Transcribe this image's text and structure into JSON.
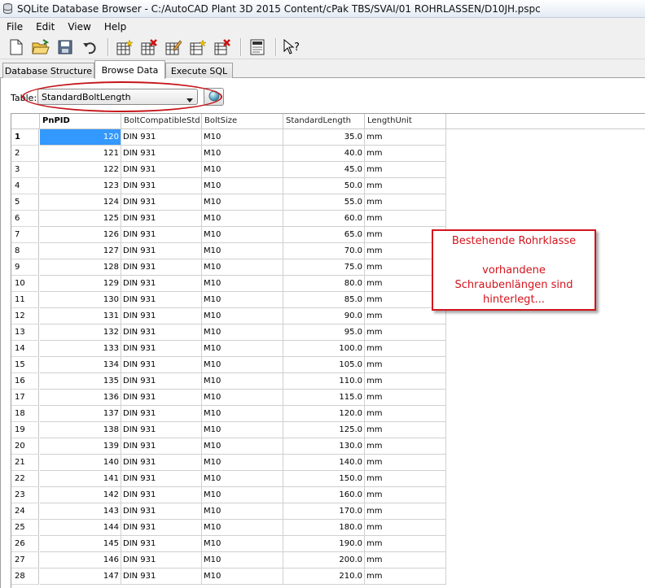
{
  "window": {
    "title": "SQLite Database Browser - C:/AutoCAD Plant 3D 2015 Content/cPak TBS/SVAI/01 ROHRLASSEN/D10JH.pspc"
  },
  "menu": [
    "File",
    "Edit",
    "View",
    "Help"
  ],
  "toolbar": {
    "buttons": [
      "new-database",
      "open-database",
      "save-database",
      "undo",
      "create-table",
      "delete-table",
      "modify-table",
      "create-index",
      "delete-index",
      "log",
      "whats-this"
    ]
  },
  "tabs": [
    {
      "label": "Database Structure",
      "active": false
    },
    {
      "label": "Browse Data",
      "active": true
    },
    {
      "label": "Execute SQL",
      "active": false
    }
  ],
  "browse": {
    "table_label": "Table:",
    "table_value": "StandardBoltLength"
  },
  "grid": {
    "columns": [
      "PnPID",
      "BoltCompatibleStd",
      "BoltSize",
      "StandardLength",
      "LengthUnit"
    ],
    "selected_cell": "120",
    "rows": [
      [
        "1",
        "120",
        "DIN 931",
        "M10",
        "35.0",
        "mm"
      ],
      [
        "2",
        "121",
        "DIN 931",
        "M10",
        "40.0",
        "mm"
      ],
      [
        "3",
        "122",
        "DIN 931",
        "M10",
        "45.0",
        "mm"
      ],
      [
        "4",
        "123",
        "DIN 931",
        "M10",
        "50.0",
        "mm"
      ],
      [
        "5",
        "124",
        "DIN 931",
        "M10",
        "55.0",
        "mm"
      ],
      [
        "6",
        "125",
        "DIN 931",
        "M10",
        "60.0",
        "mm"
      ],
      [
        "7",
        "126",
        "DIN 931",
        "M10",
        "65.0",
        "mm"
      ],
      [
        "8",
        "127",
        "DIN 931",
        "M10",
        "70.0",
        "mm"
      ],
      [
        "9",
        "128",
        "DIN 931",
        "M10",
        "75.0",
        "mm"
      ],
      [
        "10",
        "129",
        "DIN 931",
        "M10",
        "80.0",
        "mm"
      ],
      [
        "11",
        "130",
        "DIN 931",
        "M10",
        "85.0",
        "mm"
      ],
      [
        "12",
        "131",
        "DIN 931",
        "M10",
        "90.0",
        "mm"
      ],
      [
        "13",
        "132",
        "DIN 931",
        "M10",
        "95.0",
        "mm"
      ],
      [
        "14",
        "133",
        "DIN 931",
        "M10",
        "100.0",
        "mm"
      ],
      [
        "15",
        "134",
        "DIN 931",
        "M10",
        "105.0",
        "mm"
      ],
      [
        "16",
        "135",
        "DIN 931",
        "M10",
        "110.0",
        "mm"
      ],
      [
        "17",
        "136",
        "DIN 931",
        "M10",
        "115.0",
        "mm"
      ],
      [
        "18",
        "137",
        "DIN 931",
        "M10",
        "120.0",
        "mm"
      ],
      [
        "19",
        "138",
        "DIN 931",
        "M10",
        "125.0",
        "mm"
      ],
      [
        "20",
        "139",
        "DIN 931",
        "M10",
        "130.0",
        "mm"
      ],
      [
        "21",
        "140",
        "DIN 931",
        "M10",
        "140.0",
        "mm"
      ],
      [
        "22",
        "141",
        "DIN 931",
        "M10",
        "150.0",
        "mm"
      ],
      [
        "23",
        "142",
        "DIN 931",
        "M10",
        "160.0",
        "mm"
      ],
      [
        "24",
        "143",
        "DIN 931",
        "M10",
        "170.0",
        "mm"
      ],
      [
        "25",
        "144",
        "DIN 931",
        "M10",
        "180.0",
        "mm"
      ],
      [
        "26",
        "145",
        "DIN 931",
        "M10",
        "190.0",
        "mm"
      ],
      [
        "27",
        "146",
        "DIN 931",
        "M10",
        "200.0",
        "mm"
      ],
      [
        "28",
        "147",
        "DIN 931",
        "M10",
        "210.0",
        "mm"
      ]
    ]
  },
  "annotation": {
    "heading": "Bestehende Rohrklasse",
    "lines": [
      "vorhandene",
      "Schraubenlängen sind",
      "hinterlegt..."
    ],
    "color": "#d3141c"
  },
  "colors": {
    "selection": "#3399ff",
    "highlight": "#c4151a"
  }
}
